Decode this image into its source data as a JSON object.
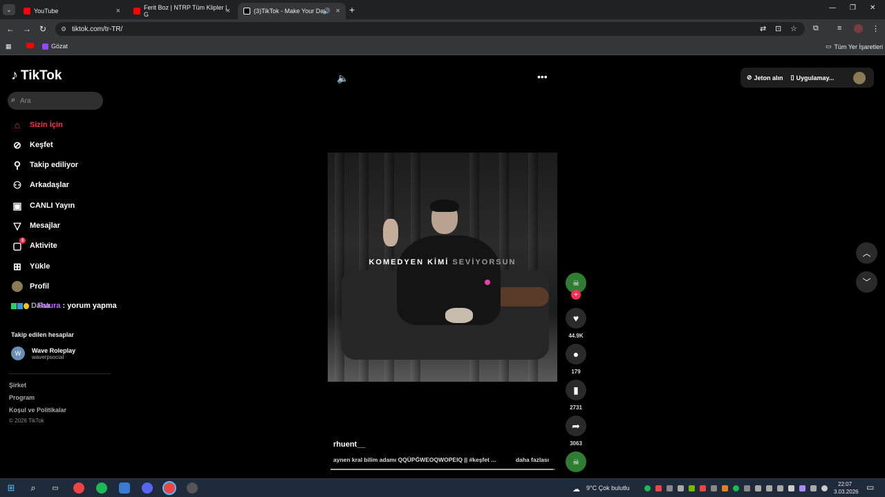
{
  "browser": {
    "tabs": [
      {
        "title": "YouTube",
        "color": "#ff0000",
        "active": false
      },
      {
        "title": "Ferit Boz | NTRP Tüm Klipler | G",
        "color": "#ff0000",
        "active": false
      },
      {
        "title": "(3)TikTok - Make Your Day",
        "color": "#ffffff",
        "active": true
      }
    ],
    "url": "tiktok.com/tr-TR/",
    "bookmarks": [
      {
        "label": "",
        "icon": "youtube-icon"
      },
      {
        "label": "Gözat",
        "icon": "twitch-icon"
      }
    ],
    "all_bookmarks": "Tüm Yer İşaretleri"
  },
  "sidebar": {
    "logo": "TikTok",
    "search_placeholder": "Ara",
    "nav": [
      {
        "label": "Sizin İçin",
        "icon": "home-icon",
        "active": true
      },
      {
        "label": "Keşfet",
        "icon": "compass-icon"
      },
      {
        "label": "Takip ediliyor",
        "icon": "following-icon"
      },
      {
        "label": "Arkadaşlar",
        "icon": "friends-icon"
      },
      {
        "label": "CANLI Yayın",
        "icon": "live-icon"
      },
      {
        "label": "Mesajlar",
        "icon": "messages-icon"
      },
      {
        "label": "Aktivite",
        "icon": "activity-icon",
        "badge": "3"
      },
      {
        "label": "Yükle",
        "icon": "upload-icon"
      },
      {
        "label": "Profil",
        "icon": "profile-icon"
      }
    ],
    "overlay_pink": "Fatura",
    "overlay_text": ": yorum yapma",
    "overlay_hidden": "Daha",
    "followed_title": "Takip edilen hesaplar",
    "account": {
      "name": "Wave Roleplay",
      "handle": "waverpsocial"
    },
    "footer": [
      "Şirket",
      "Program",
      "Koşul ve Politikalar"
    ],
    "copyright": "© 2026 TikTok"
  },
  "header": {
    "coins": "Jeton alın",
    "app": "Uygulamay..."
  },
  "video": {
    "caption_main": "KOMEDYEN KİMİ",
    "caption_dim": "SEVİYORSUN",
    "progress": 0.99
  },
  "actions": {
    "likes": "44.9K",
    "comments": "179",
    "saves": "2731",
    "shares": "3063"
  },
  "post": {
    "username": "rhuent__",
    "description": "aynen kral bilim adamı QQÜPĞWEOQWOPEIQ || #keşfet ...",
    "more": "daha fazlası"
  },
  "taskbar": {
    "weather": "9°C  Çok bulutlu",
    "time": "22:07",
    "date": "3.03.2026"
  }
}
